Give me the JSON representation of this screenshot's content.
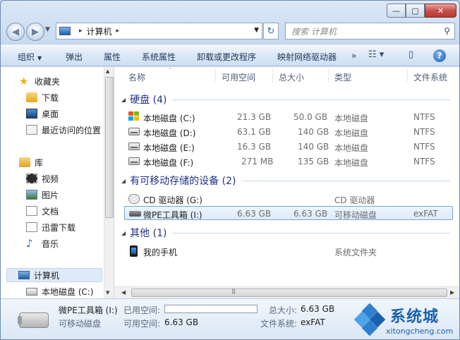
{
  "window": {
    "caption": {
      "minimize": "—",
      "maximize": "▢",
      "close": "✕"
    }
  },
  "nav": {
    "breadcrumb_arrow": "▸",
    "address_crumb": "计算机",
    "search_placeholder": "搜索 计算机"
  },
  "toolbar": {
    "organize": "组织",
    "eject": "弹出",
    "properties": "属性",
    "system_properties": "系统属性",
    "uninstall": "卸载或更改程序",
    "map_drive": "映射网络驱动器",
    "more": "»",
    "help": "?"
  },
  "sidebar": {
    "items": [
      {
        "label": "收藏夹",
        "icon": "star-icon"
      },
      {
        "label": "下载",
        "icon": "download-folder-icon"
      },
      {
        "label": "桌面",
        "icon": "desktop-icon"
      },
      {
        "label": "最近访问的位置",
        "icon": "recent-places-icon"
      },
      {
        "label": "库",
        "icon": "library-icon"
      },
      {
        "label": "视频",
        "icon": "video-icon"
      },
      {
        "label": "图片",
        "icon": "pictures-icon"
      },
      {
        "label": "文档",
        "icon": "documents-icon"
      },
      {
        "label": "迅雷下载",
        "icon": "thunder-download-icon"
      },
      {
        "label": "音乐",
        "icon": "music-icon"
      },
      {
        "label": "计算机",
        "icon": "computer-icon"
      },
      {
        "label": "本地磁盘 (C:)",
        "icon": "local-disk-icon"
      }
    ]
  },
  "columns": {
    "name": "名称",
    "free": "可用空间",
    "total": "总大小",
    "type": "类型",
    "fs": "文件系统"
  },
  "groups": {
    "hdd": "硬盘 (4)",
    "removable": "有可移动存储的设备 (2)",
    "other": "其他 (1)"
  },
  "drives": {
    "hdd": [
      {
        "name": "本地磁盘 (C:)",
        "free": "21.3 GB",
        "total": "50.0 GB",
        "type": "本地磁盘",
        "fs": "NTFS"
      },
      {
        "name": "本地磁盘 (D:)",
        "free": "63.1 GB",
        "total": "140 GB",
        "type": "本地磁盘",
        "fs": "NTFS"
      },
      {
        "name": "本地磁盘 (E:)",
        "free": "16.3 GB",
        "total": "140 GB",
        "type": "本地磁盘",
        "fs": "NTFS"
      },
      {
        "name": "本地磁盘 (F:)",
        "free": "271 MB",
        "total": "135 GB",
        "type": "本地磁盘",
        "fs": "NTFS"
      }
    ],
    "removable": [
      {
        "name": "CD 驱动器 (G:)",
        "free": "",
        "total": "",
        "type": "CD 驱动器",
        "fs": ""
      },
      {
        "name": "微PE工具箱 (I:)",
        "free": "6.63 GB",
        "total": "6.63 GB",
        "type": "可移动磁盘",
        "fs": "exFAT"
      }
    ],
    "other": [
      {
        "name": "我的手机",
        "free": "",
        "total": "",
        "type": "系统文件夹",
        "fs": ""
      }
    ]
  },
  "details": {
    "name": "微PE工具箱 (I:)",
    "kind": "可移动磁盘",
    "used_label": "已用空间:",
    "used_fraction": 0.0,
    "free_label": "可用空间:",
    "free_value": "6.63 GB",
    "total_label": "总大小:",
    "total_value": "6.63 GB",
    "fs_label": "文件系统:",
    "fs_value": "exFAT"
  },
  "watermark": {
    "title": "系统城",
    "url": "xitongcheng.com"
  },
  "colors": {
    "group_header": "#1e3287",
    "selection_border": "#7da2ce",
    "watermark_blue": "#1a62b0"
  }
}
